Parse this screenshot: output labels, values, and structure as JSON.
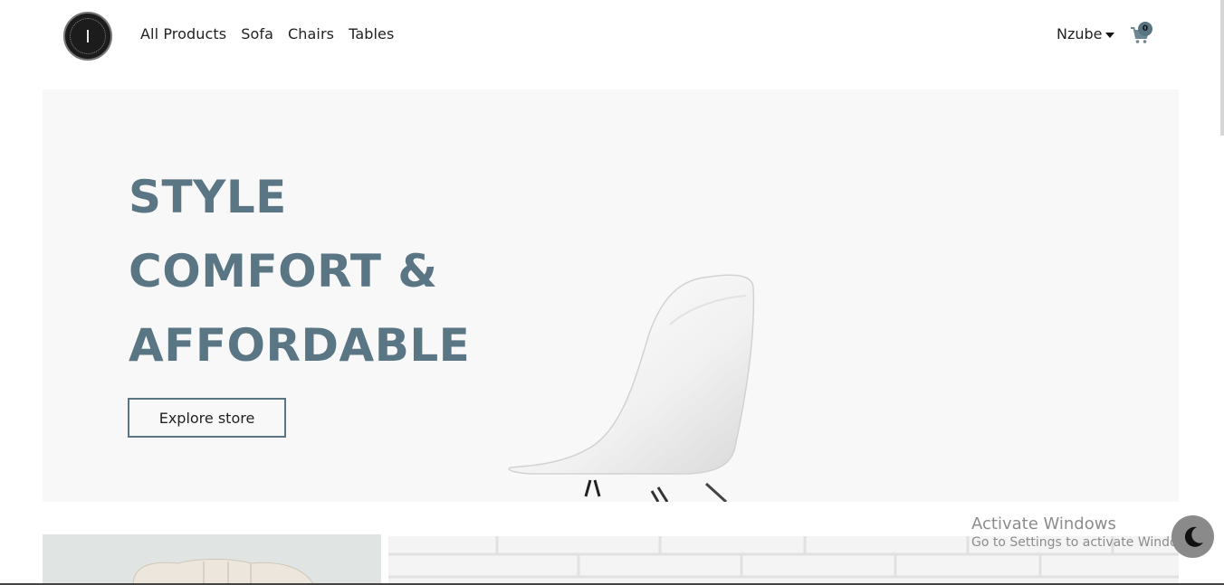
{
  "brand": {
    "logo_icon": "brand-logo-icon"
  },
  "nav": {
    "links": [
      "All Products",
      "Sofa",
      "Chairs",
      "Tables"
    ]
  },
  "user": {
    "name": "Nzube",
    "menu_icon": "caret-down-icon"
  },
  "cart": {
    "icon": "cart-icon",
    "count": "0"
  },
  "hero": {
    "lines": [
      "STYLE",
      "COMFORT &",
      "AFFORDABLE"
    ],
    "cta_label": "Explore store",
    "image": "white-chair-image"
  },
  "tiles": [
    "armchair-image",
    "white-brick-wall-image"
  ],
  "watermark": {
    "title": "Activate Windows",
    "subtitle": "Go to Settings to activate Windows."
  },
  "theme_toggle": {
    "icon": "moon-icon"
  },
  "colors": {
    "accent": "#5a7584",
    "hero_bg": "#f8f8f8",
    "badge": "#5b7482"
  }
}
